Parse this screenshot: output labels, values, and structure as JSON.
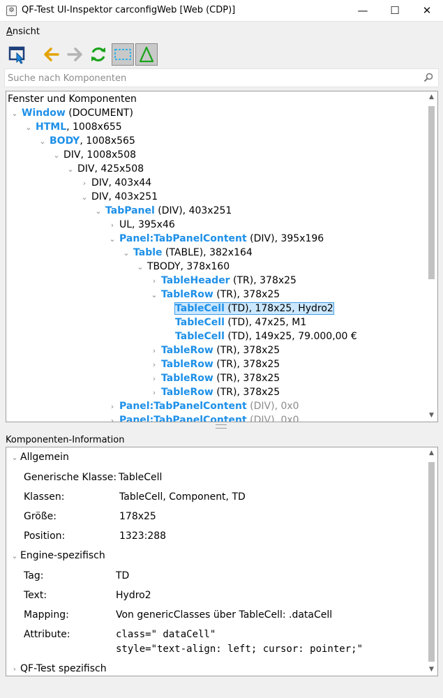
{
  "window": {
    "title": "QF-Test UI-Inspektor carconfigWeb [Web (CDP)]",
    "minimize_glyph": "—",
    "maximize_glyph": "☐",
    "close_glyph": "✕"
  },
  "menu": {
    "ansicht_first": "A",
    "ansicht_rest": "nsicht"
  },
  "toolbar": {
    "icons": [
      "select-component-icon",
      "back-arrow-icon",
      "forward-arrow-icon",
      "refresh-icon",
      "highlight-toggle-icon",
      "delta-toggle-icon"
    ],
    "colors": {
      "back": "#e3a300",
      "forward": "#b3b3b3",
      "refresh": "#1aa31a",
      "highlight": "#33b1e8",
      "delta": "#1aa31a"
    }
  },
  "search": {
    "placeholder": "Suche nach Komponenten",
    "value": ""
  },
  "tree": {
    "header": "Fenster und Komponenten",
    "rows": [
      {
        "chev": "⌄",
        "name": "Window",
        "rest": " (DOCUMENT)"
      },
      {
        "chev": "⌄",
        "name": "HTML",
        "rest": ", 1008x655"
      },
      {
        "chev": "⌄",
        "name": "BODY",
        "rest": ", 1008x565"
      },
      {
        "chev": "⌄",
        "name": "",
        "rest": "DIV, 1008x508"
      },
      {
        "chev": "⌄",
        "name": "",
        "rest": "DIV, 425x508"
      },
      {
        "chev": "›",
        "name": "",
        "rest": "DIV, 403x44"
      },
      {
        "chev": "⌄",
        "name": "",
        "rest": "DIV, 403x251"
      },
      {
        "chev": "⌄",
        "name": "TabPanel",
        "rest": " (DIV), 403x251"
      },
      {
        "chev": "›",
        "name": "",
        "rest": "UL, 395x46"
      },
      {
        "chev": "⌄",
        "name": "Panel:TabPanelContent",
        "rest": " (DIV), 395x196"
      },
      {
        "chev": "⌄",
        "name": "Table",
        "rest": " (TABLE), 382x164"
      },
      {
        "chev": "⌄",
        "name": "",
        "rest": "TBODY, 378x160"
      },
      {
        "chev": "›",
        "name": "TableHeader",
        "rest": " (TR), 378x25"
      },
      {
        "chev": "⌄",
        "name": "TableRow",
        "rest": " (TR), 378x25"
      },
      {
        "chev": "",
        "name": "TableCell",
        "rest": " (TD), 178x25, Hydro2"
      },
      {
        "chev": "",
        "name": "TableCell",
        "rest": " (TD), 47x25, M1"
      },
      {
        "chev": "",
        "name": "TableCell",
        "rest": " (TD), 149x25, 79.000,00 €"
      },
      {
        "chev": "›",
        "name": "TableRow",
        "rest": " (TR), 378x25"
      },
      {
        "chev": "›",
        "name": "TableRow",
        "rest": " (TR), 378x25"
      },
      {
        "chev": "›",
        "name": "TableRow",
        "rest": " (TR), 378x25"
      },
      {
        "chev": "›",
        "name": "TableRow",
        "rest": " (TR), 378x25"
      },
      {
        "chev": "›",
        "name": "Panel:TabPanelContent",
        "rest": " (DIV), 0x0"
      },
      {
        "chev": "›",
        "name": "Panel:TabPanelContent",
        "rest": " (DIV), 0x0"
      }
    ],
    "selected_index": 14
  },
  "info": {
    "label": "Komponenten-Information",
    "sections": {
      "allgemein": "Allgemein",
      "engine": "Engine-spezifisch",
      "qftest": "QF-Test spezifisch"
    },
    "allgemein": {
      "generic_label": "Generische Klasse:",
      "generic_value": "TableCell",
      "classes_label": "Klassen:",
      "classes_value": "TableCell, Component, TD",
      "size_label": "Größe:",
      "size_value": "178x25",
      "position_label": "Position:",
      "position_value": "1323:288"
    },
    "engine": {
      "tag_label": "Tag:",
      "tag_value": "TD",
      "text_label": "Text:",
      "text_value": "Hydro2",
      "mapping_label": "Mapping:",
      "mapping_value": "Von genericClasses über TableCell: .dataCell",
      "attr_label": "Attribute:",
      "attr_line1": "class=\" dataCell\"",
      "attr_line2": "style=\"text-align: left; cursor: pointer;\""
    }
  }
}
